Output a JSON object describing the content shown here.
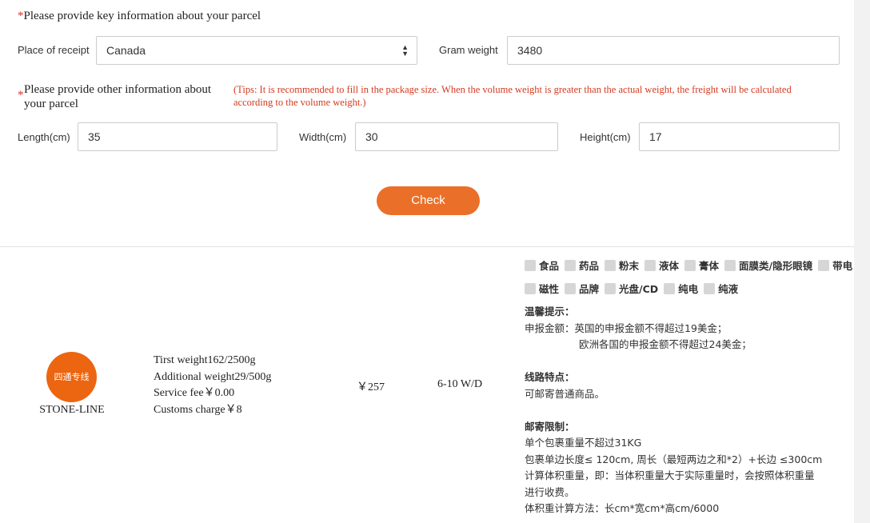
{
  "form": {
    "section1_title": "Please provide key information about your parcel",
    "required_mark": "*",
    "place_label": "Place of receipt",
    "place_value": "Canada",
    "gram_label": "Gram weight",
    "gram_value": "3480",
    "section2_title": "Please provide other information about your parcel",
    "tips": "(Tips: It is recommended to fill in the package size. When the volume weight is greater than the actual weight, the freight will be calculated according to the volume weight.)",
    "length_label": "Length(cm)",
    "length_value": "35",
    "width_label": "Width(cm)",
    "width_value": "30",
    "height_label": "Height(cm)",
    "height_value": "17",
    "check_label": "Check"
  },
  "result": {
    "logo_text": "四通专线",
    "carrier_name": "STONE-LINE",
    "fees": [
      "Tirst weight162/2500g",
      "Additional weight29/500g",
      "Service fee￥0.00",
      "Customs charge￥8"
    ],
    "price": "￥257",
    "delivery": "6-10 W/D",
    "categories_row1": [
      "食品",
      "药品",
      "粉末",
      "液体",
      "膏体",
      "面膜类/隐形眼镜",
      "带电"
    ],
    "categories_row2": [
      "磁性",
      "品牌",
      "光盘/CD",
      "纯电",
      "纯液"
    ],
    "notes": {
      "tip_title": "温馨提示：",
      "declare_line1": "申报金额：英国的申报金额不得超过19美金；",
      "declare_line2": "欧洲各国的申报金额不得超过24美金；",
      "route_title": "线路特点：",
      "route_text": "可邮寄普通商品。",
      "limit_title": "邮寄限制：",
      "limit_line1": "单个包裹重量不超过31KG",
      "limit_line2": "包裹单边长度≤ 120cm, 周长（最短两边之和*2）+长边 ≤300cm",
      "limit_line3": "计算体积重量，即：当体积重量大于实际重量时，会按照体积重量",
      "limit_line4": "进行收费。",
      "limit_line5": "体积重计算方法：长cm*宽cm*高cm/6000"
    }
  }
}
